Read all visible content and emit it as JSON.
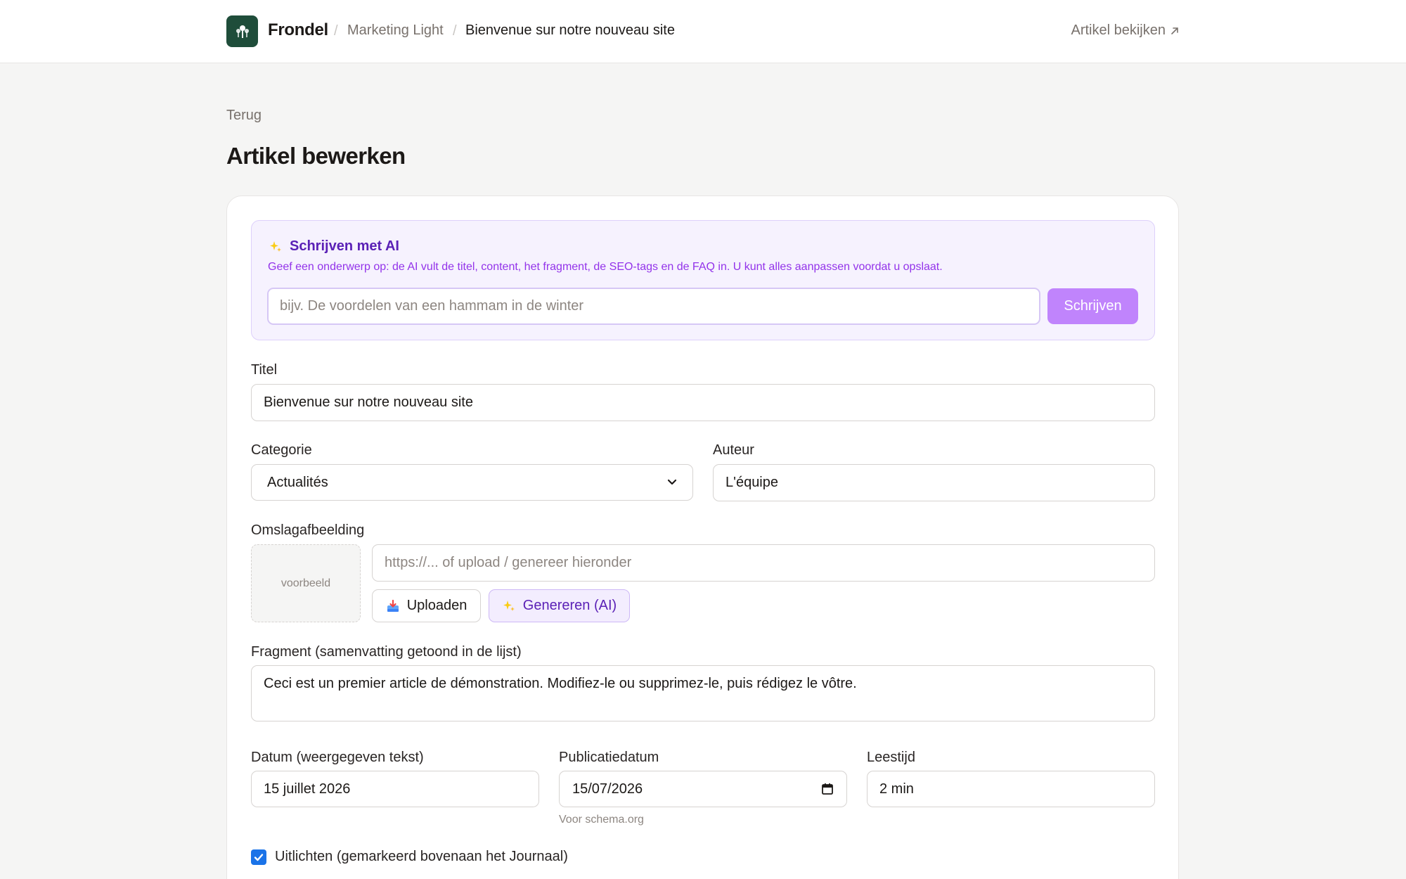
{
  "header": {
    "brand": "Frondel",
    "breadcrumb": [
      "Marketing Light",
      "Bienvenue sur notre nouveau site"
    ],
    "separator": "/",
    "view_link": "Artikel bekijken",
    "view_link_icon": "arrow-up-right-icon"
  },
  "page": {
    "back": "Terug",
    "title": "Artikel bewerken"
  },
  "ai": {
    "title": "Schrijven met AI",
    "description": "Geef een onderwerp op: de AI vult de titel, content, het fragment, de SEO-tags en de FAQ in. U kunt alles aanpassen voordat u opslaat.",
    "placeholder": "bijv. De voordelen van een hammam in de winter",
    "button": "Schrijven",
    "icon": "sparkles-icon"
  },
  "form": {
    "title_label": "Titel",
    "title_value": "Bienvenue sur notre nouveau site",
    "category_label": "Categorie",
    "category_value": "Actualités",
    "author_label": "Auteur",
    "author_value": "L'équipe",
    "cover_label": "Omslagafbeelding",
    "cover_preview": "voorbeeld",
    "cover_placeholder": "https://... of upload / genereer hieronder",
    "upload_button": "Uploaden",
    "generate_button": "Genereren (AI)",
    "excerpt_label": "Fragment (samenvatting getoond in de lijst)",
    "excerpt_value": "Ceci est un premier article de démonstration. Modifiez-le ou supprimez-le, puis rédigez le vôtre.",
    "date_text_label": "Datum (weergegeven tekst)",
    "date_text_value": "15 juillet 2026",
    "pub_date_label": "Publicatiedatum",
    "pub_date_value": "15/07/2026",
    "pub_date_hint": "Voor schema.org",
    "reading_time_label": "Leestijd",
    "reading_time_value": "2 min",
    "featured_label": "Uitlichten (gemarkeerd bovenaan het Journaal)",
    "featured_checked": true
  },
  "colors": {
    "brand": "#1f4d3a",
    "ai_accent": "#5b21b6",
    "ai_button": "#c084fc",
    "checkbox": "#1a73e8"
  }
}
